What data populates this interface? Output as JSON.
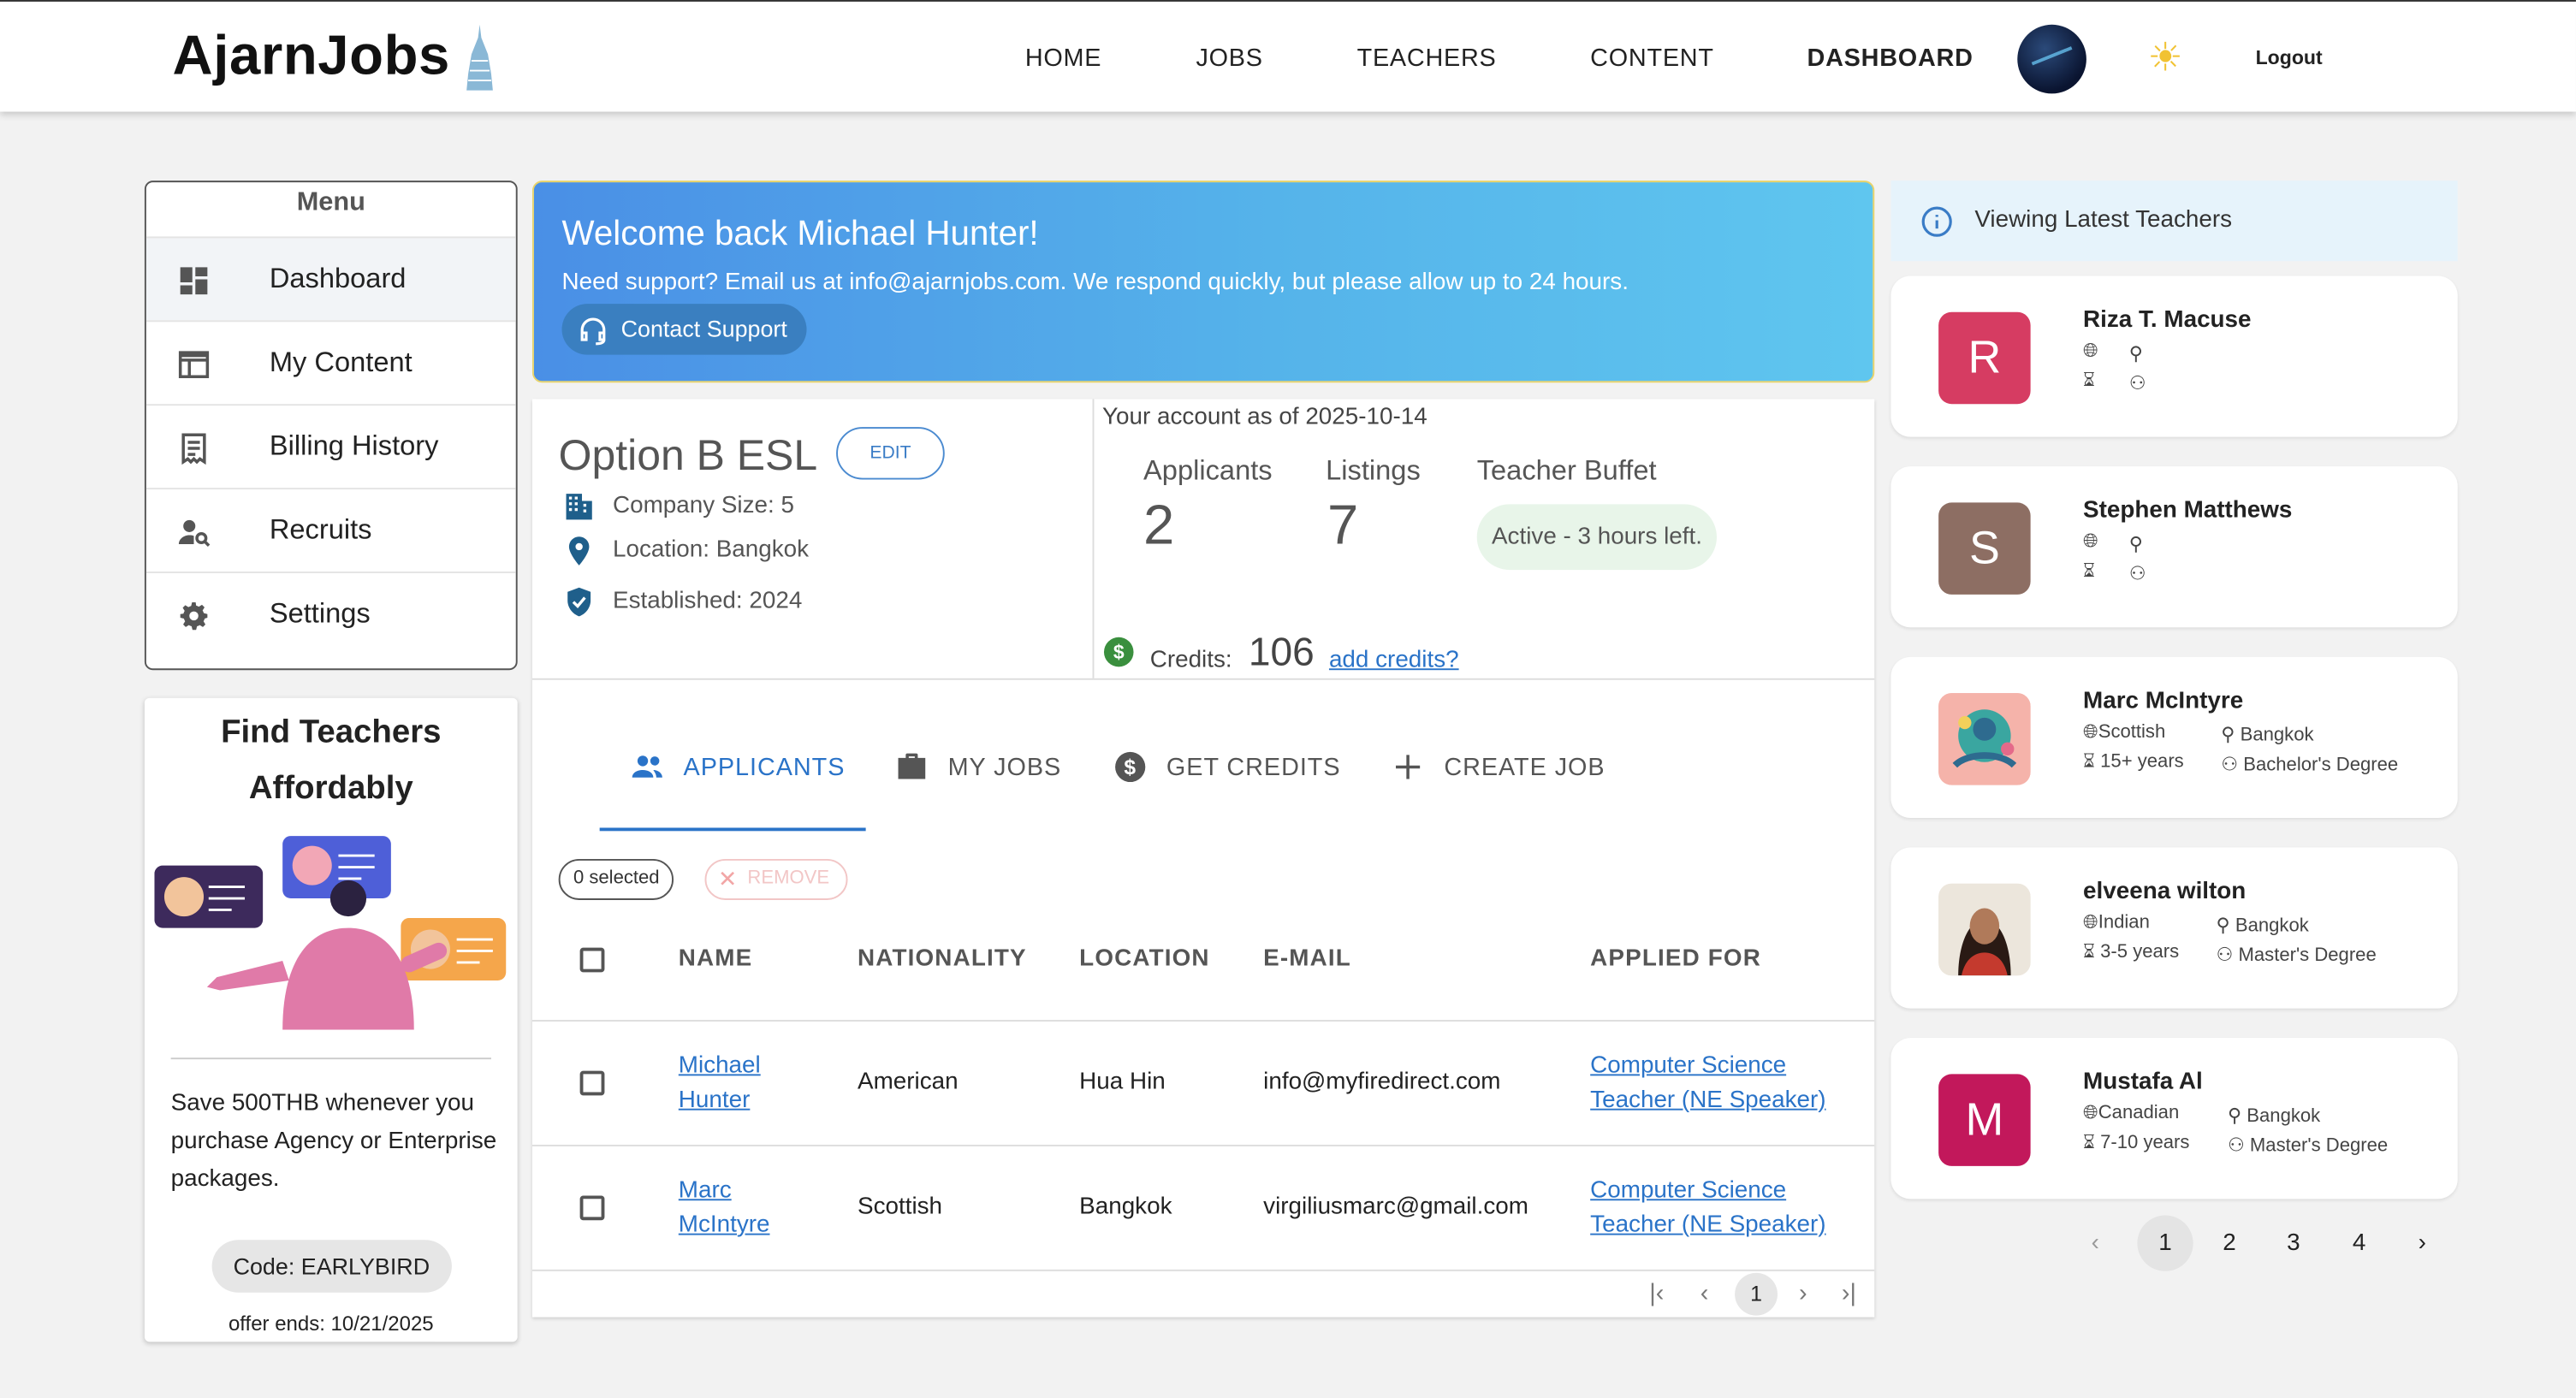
{
  "header": {
    "logo": "AjarnJobs",
    "nav": [
      "HOME",
      "JOBS",
      "TEACHERS",
      "CONTENT",
      "DASHBOARD"
    ],
    "logout": "Logout"
  },
  "menu": {
    "title": "Menu",
    "items": [
      {
        "label": "Dashboard",
        "icon": "dashboard-icon"
      },
      {
        "label": "My Content",
        "icon": "content-icon"
      },
      {
        "label": "Billing History",
        "icon": "receipt-icon"
      },
      {
        "label": "Recruits",
        "icon": "person-search-icon"
      },
      {
        "label": "Settings",
        "icon": "gear-icon"
      }
    ]
  },
  "promo": {
    "title": "Find Teachers Affordably",
    "description": "Save 500THB whenever you purchase Agency or Enterprise packages.",
    "code": "Code: EARLYBIRD",
    "ends": "offer ends: 10/21/2025"
  },
  "welcome": {
    "title": "Welcome back Michael Hunter!",
    "subtitle": "Need support? Email us at info@ajarnjobs.com. We respond quickly, but please allow up to 24 hours.",
    "button": "Contact Support"
  },
  "company": {
    "name": "Option B ESL",
    "edit": "EDIT",
    "size": "Company Size: 5",
    "location": "Location: Bangkok",
    "established": "Established: 2024"
  },
  "account": {
    "as_of": "Your account as of 2025-10-14",
    "applicants_label": "Applicants",
    "applicants_value": "2",
    "listings_label": "Listings",
    "listings_value": "7",
    "buffet_label": "Teacher Buffet",
    "buffet_status": "Active - 3 hours left.",
    "credits_label": "Credits:",
    "credits_value": "106",
    "credits_link": "add credits?"
  },
  "tabs": [
    "APPLICANTS",
    "MY JOBS",
    "GET CREDITS",
    "CREATE JOB"
  ],
  "table": {
    "selected": "0 selected",
    "remove": "REMOVE",
    "columns": [
      "NAME",
      "NATIONALITY",
      "LOCATION",
      "E-MAIL",
      "APPLIED FOR"
    ],
    "rows": [
      {
        "name1": "Michael",
        "name2": "Hunter",
        "nationality": "American",
        "location": "Hua Hin",
        "email": "info@myfiredirect.com",
        "applied1": "Computer Science",
        "applied2": "Teacher (NE Speaker)"
      },
      {
        "name1": "Marc",
        "name2": "McIntyre",
        "nationality": "Scottish",
        "location": "Bangkok",
        "email": "virgiliusmarc@gmail.com",
        "applied1": "Computer Science",
        "applied2": "Teacher (NE Speaker)"
      }
    ],
    "page": "1"
  },
  "teachers": {
    "banner": "Viewing Latest Teachers",
    "list": [
      {
        "initial": "R",
        "name": "Riza T. Macuse",
        "nationality": "",
        "location": "",
        "experience": "",
        "degree": "",
        "color": "#d63c62"
      },
      {
        "initial": "S",
        "name": "Stephen Matthews",
        "nationality": "",
        "location": "",
        "experience": "",
        "degree": "",
        "color": "#8d6e63"
      },
      {
        "initial": "",
        "name": "Marc McIntyre",
        "nationality": "Scottish",
        "location": "Bangkok",
        "experience": "15+ years",
        "degree": "Bachelor's Degree",
        "color": "#f2a7a0"
      },
      {
        "initial": "",
        "name": "elveena wilton",
        "nationality": "Indian",
        "location": "Bangkok",
        "experience": "3-5 years",
        "degree": "Master's Degree",
        "color": "#7a4a3a"
      },
      {
        "initial": "M",
        "name": "Mustafa Al",
        "nationality": "Canadian",
        "location": "Bangkok",
        "experience": "7-10 years",
        "degree": "Master's Degree",
        "color": "#c2185b"
      }
    ],
    "pages": [
      "1",
      "2",
      "3",
      "4"
    ]
  }
}
